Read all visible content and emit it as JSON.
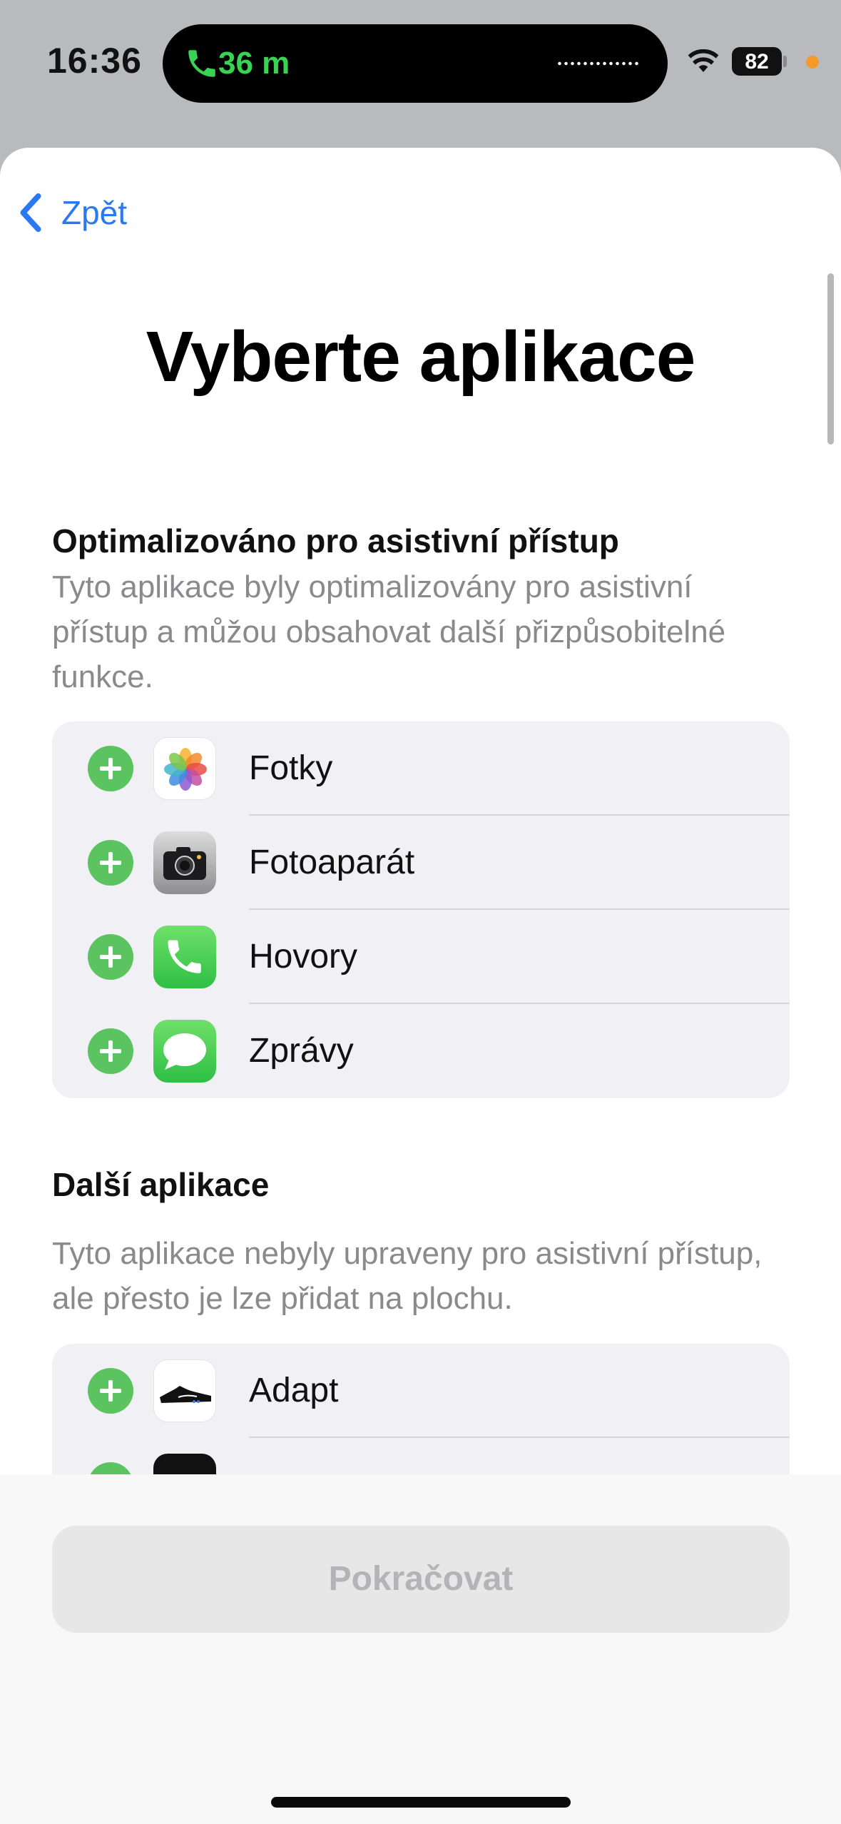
{
  "status_bar": {
    "time": "16:36",
    "call_duration": "36 m",
    "battery": "82",
    "call_color": "#39d353"
  },
  "nav": {
    "back_label": "Zpět"
  },
  "title": "Vyberte aplikace",
  "optimized": {
    "title": "Optimalizováno pro asistivní přístup",
    "description": "Tyto aplikace byly optimalizovány pro asistivní přístup a můžou obsahovat další přizpůsobitelné funkce.",
    "apps": [
      {
        "label": "Fotky",
        "icon": "photos-icon"
      },
      {
        "label": "Fotoaparát",
        "icon": "camera-icon"
      },
      {
        "label": "Hovory",
        "icon": "phone-icon"
      },
      {
        "label": "Zprávy",
        "icon": "messages-icon"
      }
    ]
  },
  "other": {
    "title": "Další aplikace",
    "description": "Tyto aplikace nebyly upraveny pro asistivní přístup, ale přesto je lze přidat na plochu.",
    "apps": [
      {
        "label": "Adapt",
        "icon": "nike-shoe-icon"
      }
    ]
  },
  "continue_label": "Pokračovat",
  "colors": {
    "accent": "#2a78f2",
    "add_green": "#5cc361"
  }
}
